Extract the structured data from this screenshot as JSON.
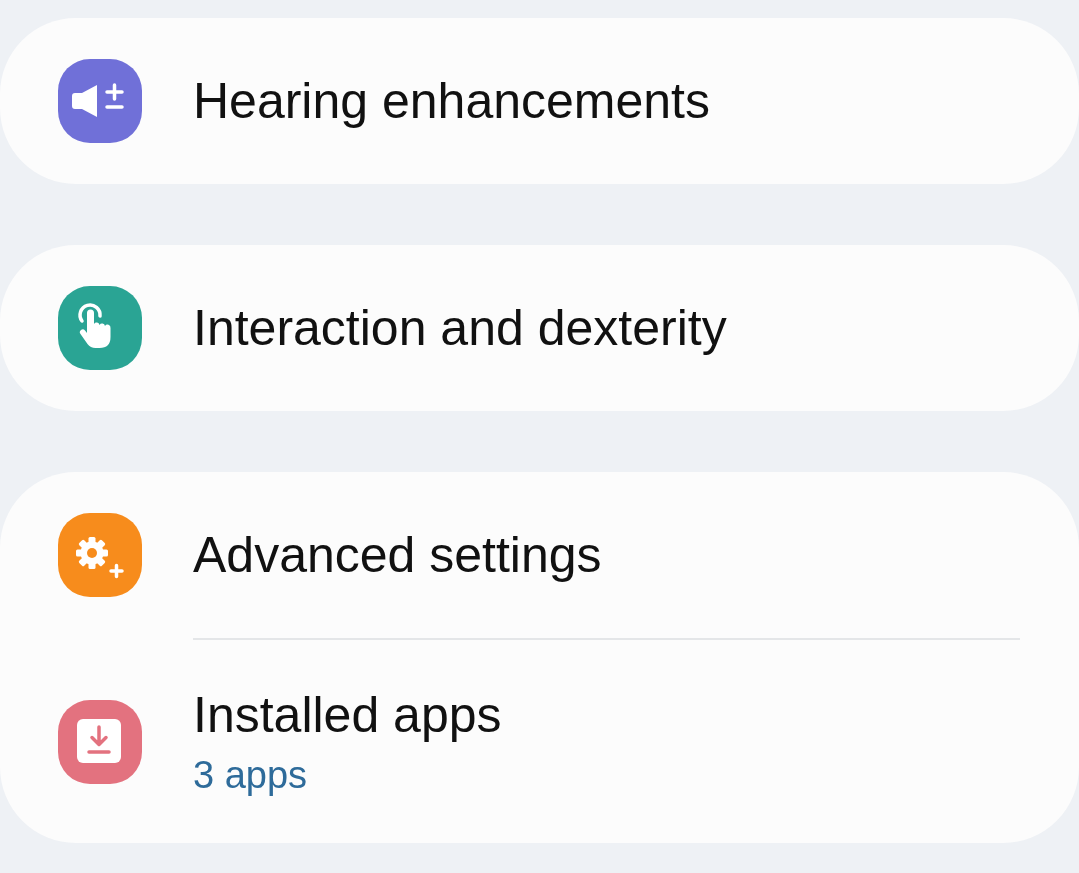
{
  "groups": [
    {
      "items": [
        {
          "title": "Hearing enhancements",
          "color": "#7070d8"
        }
      ]
    },
    {
      "items": [
        {
          "title": "Interaction and dexterity",
          "color": "#2aa494"
        }
      ]
    },
    {
      "items": [
        {
          "title": "Advanced settings",
          "color": "#f78c1c"
        },
        {
          "title": "Installed apps",
          "subtitle": "3 apps",
          "color": "#e3727f"
        }
      ]
    }
  ]
}
